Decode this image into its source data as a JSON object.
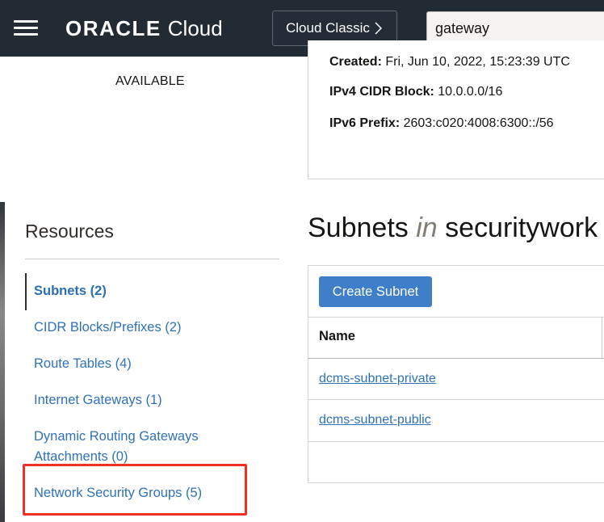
{
  "header": {
    "brand_bold": "ORACLE",
    "brand_light": "Cloud",
    "classic_label": "Cloud Classic",
    "search_value": "gateway"
  },
  "left_status": "AVAILABLE",
  "details": {
    "created_label": "Created:",
    "created_value": "Fri, Jun 10, 2022, 15:23:39 UTC",
    "ipv4_label": "IPv4 CIDR Block:",
    "ipv4_value": "10.0.0.0/16",
    "ipv6_label": "IPv6 Prefix:",
    "ipv6_value": "2603:c020:4008:6300::/56"
  },
  "resources": {
    "title": "Resources",
    "items": [
      {
        "label": "Subnets (2)",
        "active": true
      },
      {
        "label": "CIDR Blocks/Prefixes (2)"
      },
      {
        "label": "Route Tables (4)"
      },
      {
        "label": "Internet Gateways (1)"
      },
      {
        "label": "Dynamic Routing Gateways"
      },
      {
        "label": "Attachments (0)"
      },
      {
        "label": "Network Security Groups (5)",
        "highlighted": true
      }
    ]
  },
  "subnets": {
    "heading_prefix": "Subnets",
    "heading_in": "in",
    "heading_suffix": "securitywork",
    "create_button": "Create Subnet",
    "column_name": "Name",
    "rows": [
      "dcms-subnet-private",
      "dcms-subnet-public"
    ]
  },
  "colors": {
    "header_bg": "#222b34",
    "link": "#2f72b7",
    "primary_button": "#3f7ec9",
    "highlight": "#ee3124"
  }
}
